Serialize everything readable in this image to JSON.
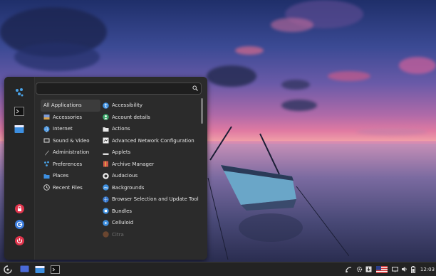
{
  "search": {
    "placeholder": "",
    "value": ""
  },
  "categories": [
    {
      "label": "All Applications",
      "icon": "all-apps-icon",
      "selected": true
    },
    {
      "label": "Accessories",
      "icon": "accessories-icon"
    },
    {
      "label": "Internet",
      "icon": "globe-icon"
    },
    {
      "label": "Sound & Video",
      "icon": "sound-video-icon"
    },
    {
      "label": "Administration",
      "icon": "administration-icon"
    },
    {
      "label": "Preferences",
      "icon": "preferences-icon"
    },
    {
      "label": "Places",
      "icon": "folder-icon"
    },
    {
      "label": "Recent Files",
      "icon": "recent-files-icon"
    }
  ],
  "apps": [
    {
      "label": "Accessibility",
      "icon": "accessibility-icon"
    },
    {
      "label": "Account details",
      "icon": "account-icon"
    },
    {
      "label": "Actions",
      "icon": "actions-folder-icon"
    },
    {
      "label": "Advanced Network Configuration",
      "icon": "network-config-icon"
    },
    {
      "label": "Applets",
      "icon": "applets-icon"
    },
    {
      "label": "Archive Manager",
      "icon": "archive-icon"
    },
    {
      "label": "Audacious",
      "icon": "audacious-icon"
    },
    {
      "label": "Backgrounds",
      "icon": "backgrounds-icon"
    },
    {
      "label": "Browser Selection and Update Tool",
      "icon": "browser-selection-icon"
    },
    {
      "label": "Bundles",
      "icon": "bundles-icon"
    },
    {
      "label": "Celluloid",
      "icon": "celluloid-icon"
    },
    {
      "label": "Citra",
      "icon": "citra-icon"
    }
  ],
  "colors": {
    "accent": "#3d8fe0",
    "lock": "#e0344c",
    "logout": "#3d7fe0",
    "power": "#e0344c"
  },
  "tray": {
    "time": "12:03"
  }
}
